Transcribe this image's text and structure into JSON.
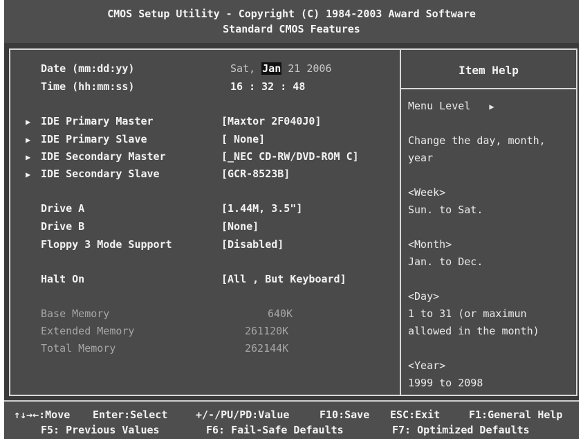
{
  "header": {
    "line1": "CMOS Setup Utility - Copyright (C) 1984-2003 Award Software",
    "line2": "Standard CMOS Features"
  },
  "items": [
    {
      "label": "Date (mm:dd:yy)",
      "value_pre": "Sat, ",
      "value_sel": "Jan",
      "value_post": " 21 2006"
    },
    {
      "label": "Time (hh:mm:ss)",
      "value": "16 : 32 : 48"
    },
    {
      "label": "IDE Primary Master",
      "value": "[Maxtor 2F040J0]"
    },
    {
      "label": "IDE Primary Slave",
      "value": "[ None]"
    },
    {
      "label": "IDE Secondary Master",
      "value": "[_NEC CD-RW/DVD-ROM C]"
    },
    {
      "label": "IDE Secondary Slave",
      "value": "[GCR-8523B]"
    },
    {
      "label": "Drive A",
      "value": "[1.44M, 3.5\"]"
    },
    {
      "label": "Drive B",
      "value": "[None]"
    },
    {
      "label": "Floppy 3 Mode Support",
      "value": "[Disabled]"
    },
    {
      "label": "Halt On",
      "value": "[All , But Keyboard]"
    },
    {
      "label": "Base Memory",
      "value": "640K"
    },
    {
      "label": "Extended Memory",
      "value": "261120K"
    },
    {
      "label": "Total Memory",
      "value": "262144K"
    }
  ],
  "help": {
    "title": "Item Help",
    "menu_level": "Menu Level",
    "lines": [
      "Change the day, month,",
      "year",
      "<Week>",
      "Sun. to Sat.",
      "<Month>",
      "Jan. to Dec.",
      "<Day>",
      "1 to 31 (or maximun",
      "allowed in the month)",
      "<Year>",
      "1999 to 2098"
    ]
  },
  "footer": {
    "move": "↑↓→←:Move",
    "enter": "Enter:Select",
    "value": "+/-/PU/PD:Value",
    "save": "F10:Save",
    "exit": "ESC:Exit",
    "general_help": "F1:General Help",
    "previous": "F5: Previous Values",
    "failsafe": "F6: Fail-Safe Defaults",
    "optimized": "F7: Optimized Defaults"
  },
  "icons": {
    "submenu": "submenu-arrow-icon"
  }
}
